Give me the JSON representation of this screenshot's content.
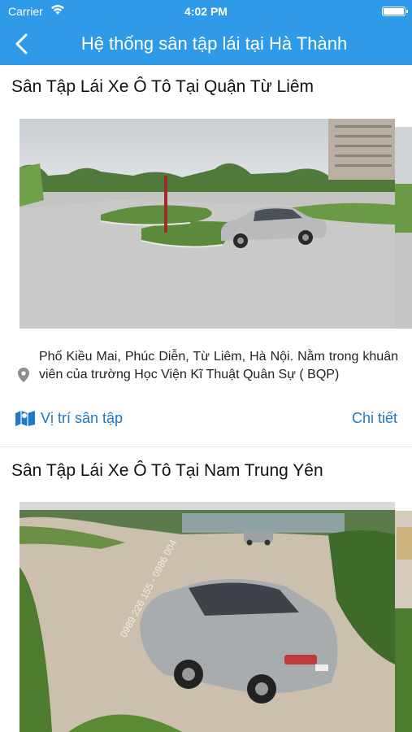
{
  "status_bar": {
    "carrier": "Carrier",
    "time": "4:02 PM",
    "wifi_icon": "wifi-icon",
    "battery_icon": "battery-icon"
  },
  "nav": {
    "back_icon": "chevron-left-icon",
    "title": "Hệ thống sân tập lái tại Hà Thành",
    "background_color": "#2f9ae8"
  },
  "cards": [
    {
      "title": "Sân Tập Lái Xe Ô Tô Tại Quận Từ Liêm",
      "image_alt": "Driving practice yard with silver sedan",
      "address": "Phố Kiều Mai, Phúc Diễn, Từ Liêm, Hà Nội. Nằm trong khuân viên của trường Học Viện Kĩ Thuật Quân Sự ( BQP)",
      "map_link_label": "Vị trí sân tập",
      "detail_link_label": "Chi tiết"
    },
    {
      "title": "Sân Tập Lái Xe Ô Tô Tại Nam Trung Yên",
      "image_alt": "Driving practice yard with silver sedan close-up",
      "watermark": "0989 226 155 - 0986 004",
      "address": "",
      "map_link_label": "",
      "detail_link_label": ""
    }
  ],
  "colors": {
    "accent": "#2f9ae8",
    "link": "#1e78c8"
  }
}
